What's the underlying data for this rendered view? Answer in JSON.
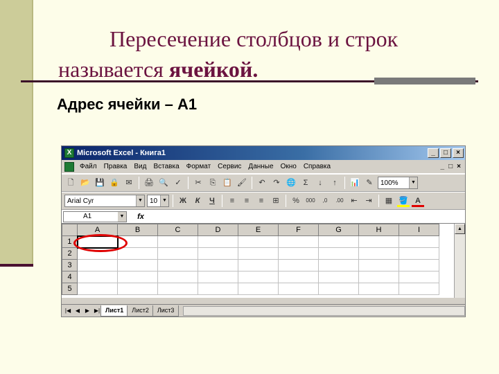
{
  "slide": {
    "title_line1": "Пересечение столбцов и строк",
    "title_line2_prefix": "называется ",
    "title_line2_bold": "ячейкой.",
    "subtitle": "Адрес ячейки – А1"
  },
  "window": {
    "title": "Microsoft Excel - Книга1",
    "app_icon": "X",
    "minimize": "_",
    "maximize": "□",
    "close": "×"
  },
  "menu": {
    "items": [
      "Файл",
      "Правка",
      "Вид",
      "Вставка",
      "Формат",
      "Сервис",
      "Данные",
      "Окно",
      "Справка"
    ],
    "doc_controls": [
      "_",
      "□",
      "×"
    ]
  },
  "toolbar_standard": {
    "icons": [
      "new-icon",
      "open-icon",
      "save-icon",
      "permission-icon",
      "email-icon",
      "print-icon",
      "print-preview-icon",
      "spelling-icon",
      "cut-icon",
      "copy-icon",
      "paste-icon",
      "format-painter-icon",
      "undo-icon",
      "redo-icon",
      "hyperlink-icon",
      "autosum-icon",
      "sort-asc-icon",
      "sort-desc-icon",
      "chart-wizard-icon",
      "drawing-icon"
    ],
    "glyphs": [
      "🗋",
      "📂",
      "💾",
      "🔒",
      "✉",
      "🖨",
      "🔍",
      "✓",
      "✂",
      "⎘",
      "📋",
      "🖌",
      "↶",
      "↷",
      "🌐",
      "Σ",
      "↓",
      "↑",
      "📊",
      "✎"
    ],
    "zoom": "100%"
  },
  "toolbar_format": {
    "font": "Arial Cyr",
    "size": "10",
    "bold": "Ж",
    "italic": "К",
    "underline": "Ч",
    "align_glyphs": [
      "≡",
      "≡",
      "≡",
      "⊞"
    ],
    "number_glyphs": [
      "%",
      "000",
      ",0",
      ".00"
    ],
    "indent_glyphs": [
      "⇤",
      "⇥"
    ],
    "misc_glyphs": [
      "▦",
      "🪣",
      "A"
    ],
    "colors": {
      "fill": "#FFFF00",
      "font": "#E00000"
    }
  },
  "formula_bar": {
    "name_box": "A1",
    "fx": "fx"
  },
  "grid": {
    "columns": [
      "A",
      "B",
      "C",
      "D",
      "E",
      "F",
      "G",
      "H",
      "I"
    ],
    "rows": [
      "1",
      "2",
      "3",
      "4",
      "5"
    ],
    "active_cell": "A1",
    "highlight_color": "#E00000"
  },
  "sheets": {
    "nav": [
      "|◀",
      "◀",
      "▶",
      "▶|"
    ],
    "tabs": [
      "Лист1",
      "Лист2",
      "Лист3"
    ],
    "active": "Лист1"
  }
}
